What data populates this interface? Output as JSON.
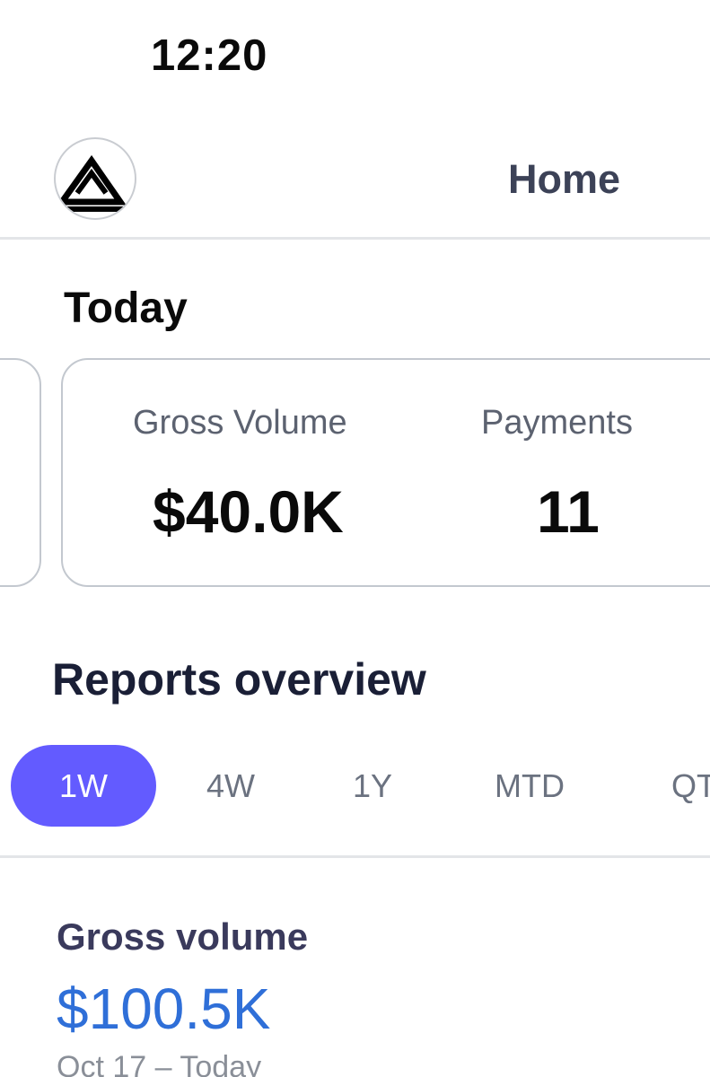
{
  "status_bar": {
    "time": "12:20"
  },
  "header": {
    "title": "Home",
    "logo_icon": "triangle-logo-icon"
  },
  "today": {
    "title": "Today",
    "metrics": [
      {
        "label": "Gross Volume",
        "value": "$40.0K"
      },
      {
        "label": "Payments",
        "value": "11"
      }
    ]
  },
  "reports": {
    "title": "Reports overview",
    "tabs": [
      {
        "label": "1W",
        "selected": true
      },
      {
        "label": "4W",
        "selected": false
      },
      {
        "label": "1Y",
        "selected": false
      },
      {
        "label": "MTD",
        "selected": false
      },
      {
        "label": "QTD",
        "selected": false
      }
    ],
    "gross_volume": {
      "title": "Gross volume",
      "value": "$100.5K",
      "range": "Oct 17 – Today"
    }
  },
  "colors": {
    "accent": "#635bff",
    "value_link": "#2f6fd8",
    "heading": "#1a1f36",
    "muted": "#6b7280"
  }
}
